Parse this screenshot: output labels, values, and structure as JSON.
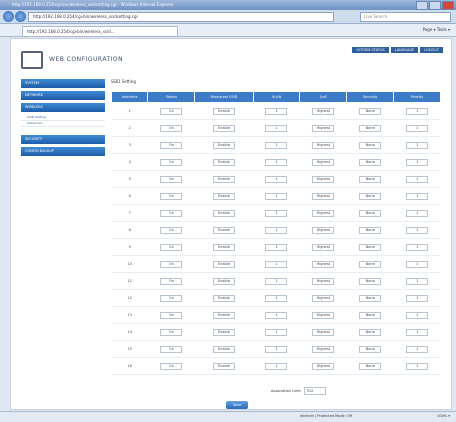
{
  "browser": {
    "title": "http://192.168.0.254/cgi-bin/wireless_ssidsetting.cgi - Windows Internet Explorer",
    "url": "http://192.168.0.254/cgi-bin/wireless_ssidsetting.cgi",
    "search_placeholder": "Live Search",
    "tab_label": "http://192.168.0.254/cgi-bin/wireless_ssid...",
    "tools": "Page ▾   Tools ▾",
    "status_left": "Internet | Protected Mode: Off",
    "status_zoom": "100% ▾"
  },
  "header": {
    "brand": "WEB CONFIGURATION",
    "links": [
      "SYSTEM STATUS",
      "LANGUAGE",
      "LOGOUT"
    ]
  },
  "sidebar": {
    "items": [
      "SYSTEM",
      "NETWORK",
      "WIRELESS"
    ],
    "subitems": [
      "SSID Setting",
      "Advanced"
    ],
    "items2": [
      "SECURITY",
      "CONFIG BACKUP"
    ]
  },
  "main": {
    "title": "SSID Setting",
    "columns": [
      "Interface",
      "Status",
      "Broadcast SSID",
      "VLAN",
      "QoS",
      "Security",
      "Priority"
    ],
    "rows": [
      {
        "n": "1",
        "status": "On",
        "bcast": "Enable",
        "vlan": "1",
        "qos": "Highest",
        "sec": "None",
        "pri": "1"
      },
      {
        "n": "2",
        "status": "On",
        "bcast": "Enable",
        "vlan": "1",
        "qos": "Highest",
        "sec": "None",
        "pri": "1"
      },
      {
        "n": "3",
        "status": "On",
        "bcast": "Enable",
        "vlan": "1",
        "qos": "Highest",
        "sec": "None",
        "pri": "1"
      },
      {
        "n": "4",
        "status": "On",
        "bcast": "Enable",
        "vlan": "1",
        "qos": "Highest",
        "sec": "None",
        "pri": "1"
      },
      {
        "n": "5",
        "status": "On",
        "bcast": "Enable",
        "vlan": "1",
        "qos": "Highest",
        "sec": "None",
        "pri": "1"
      },
      {
        "n": "6",
        "status": "On",
        "bcast": "Enable",
        "vlan": "1",
        "qos": "Highest",
        "sec": "None",
        "pri": "1"
      },
      {
        "n": "7",
        "status": "On",
        "bcast": "Enable",
        "vlan": "1",
        "qos": "Highest",
        "sec": "None",
        "pri": "1"
      },
      {
        "n": "8",
        "status": "On",
        "bcast": "Enable",
        "vlan": "1",
        "qos": "Highest",
        "sec": "None",
        "pri": "1"
      },
      {
        "n": "9",
        "status": "On",
        "bcast": "Enable",
        "vlan": "1",
        "qos": "Highest",
        "sec": "None",
        "pri": "1"
      },
      {
        "n": "10",
        "status": "On",
        "bcast": "Enable",
        "vlan": "1",
        "qos": "Highest",
        "sec": "None",
        "pri": "1"
      },
      {
        "n": "11",
        "status": "On",
        "bcast": "Enable",
        "vlan": "1",
        "qos": "Highest",
        "sec": "None",
        "pri": "1"
      },
      {
        "n": "12",
        "status": "On",
        "bcast": "Enable",
        "vlan": "1",
        "qos": "Highest",
        "sec": "None",
        "pri": "1"
      },
      {
        "n": "13",
        "status": "On",
        "bcast": "Enable",
        "vlan": "1",
        "qos": "Highest",
        "sec": "None",
        "pri": "1"
      },
      {
        "n": "14",
        "status": "On",
        "bcast": "Enable",
        "vlan": "1",
        "qos": "Highest",
        "sec": "None",
        "pri": "1"
      },
      {
        "n": "15",
        "status": "On",
        "bcast": "Enable",
        "vlan": "1",
        "qos": "Highest",
        "sec": "None",
        "pri": "1"
      },
      {
        "n": "16",
        "status": "On",
        "bcast": "Enable",
        "vlan": "1",
        "qos": "Highest",
        "sec": "None",
        "pri": "1"
      }
    ],
    "bottom_label": "Association Limit",
    "bottom_value": "512",
    "save_label": "Save"
  }
}
